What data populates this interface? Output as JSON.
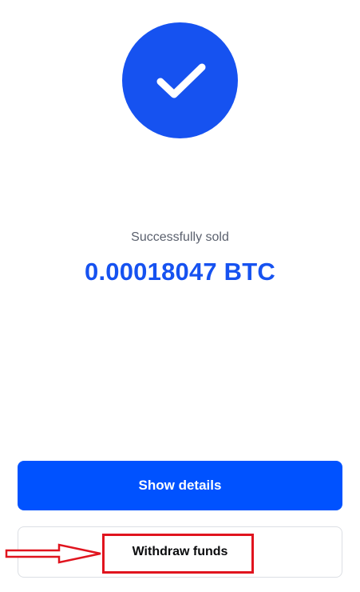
{
  "success": {
    "icon": "checkmark-icon",
    "status_text": "Successfully sold",
    "amount": "0.00018047 BTC"
  },
  "actions": {
    "show_details_label": "Show details",
    "withdraw_funds_label": "Withdraw funds"
  },
  "annotation": {
    "arrow_icon": "arrow-right-icon",
    "highlight_color": "#e0141e"
  },
  "colors": {
    "accent": "#1652F0",
    "primary_button": "#0052FF",
    "status_text": "#5b616e",
    "background": "#ffffff"
  }
}
